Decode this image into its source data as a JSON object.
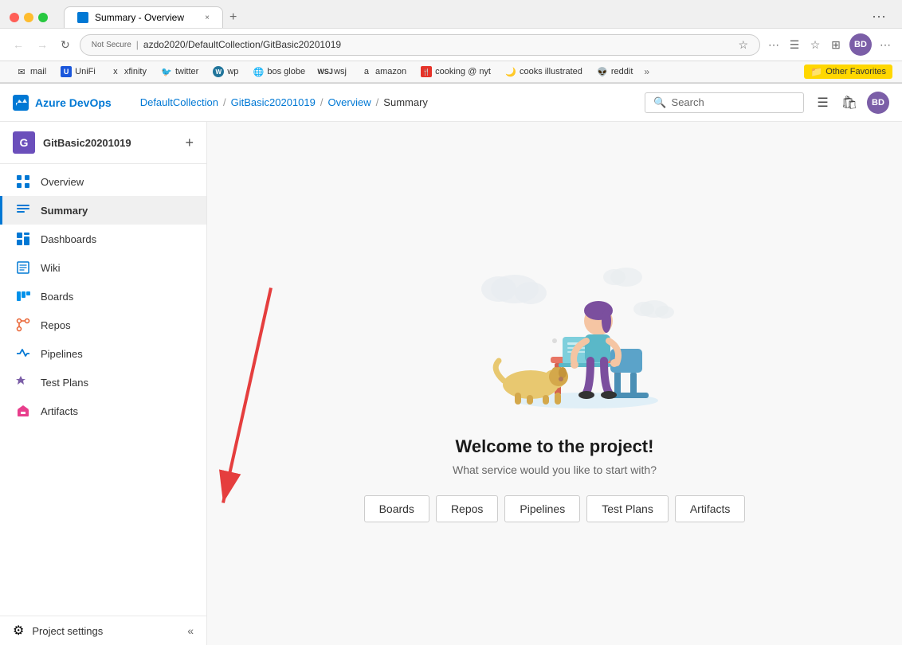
{
  "browser": {
    "tab_title": "Summary - Overview",
    "tab_close": "×",
    "tab_new": "+",
    "nav_back": "←",
    "nav_forward": "→",
    "nav_refresh": "↺",
    "url_secure": "Not Secure",
    "url_address": "azdo2020/DefaultCollection/GitBasic20201019",
    "bookmarks": [
      {
        "label": "mail",
        "icon": "✉"
      },
      {
        "label": "UniFi",
        "icon": "U"
      },
      {
        "label": "xfinity",
        "icon": "x"
      },
      {
        "label": "twitter",
        "icon": "🐦"
      },
      {
        "label": "wp",
        "icon": "W"
      },
      {
        "label": "bos globe",
        "icon": "b"
      },
      {
        "label": "wsj",
        "icon": "W"
      },
      {
        "label": "amazon",
        "icon": "a"
      },
      {
        "label": "cooking @ nyt",
        "icon": "🍴"
      },
      {
        "label": "cooks illustrated",
        "icon": "🌙"
      },
      {
        "label": "reddit",
        "icon": "👽"
      }
    ],
    "other_favorites": "Other Favorites"
  },
  "ado_header": {
    "logo_text": "Azure DevOps",
    "breadcrumb": [
      {
        "label": "DefaultCollection",
        "link": true
      },
      {
        "label": "GitBasic20201019",
        "link": true
      },
      {
        "label": "Overview",
        "link": true
      },
      {
        "label": "Summary",
        "link": false
      }
    ],
    "search_placeholder": "Search",
    "user_initials": "BD"
  },
  "sidebar": {
    "project_initial": "G",
    "project_name": "GitBasic20201019",
    "add_label": "+",
    "nav_items": [
      {
        "label": "Overview",
        "active": false,
        "icon": "overview"
      },
      {
        "label": "Summary",
        "active": true,
        "icon": "summary"
      },
      {
        "label": "Dashboards",
        "active": false,
        "icon": "dashboards"
      },
      {
        "label": "Wiki",
        "active": false,
        "icon": "wiki"
      },
      {
        "label": "Boards",
        "active": false,
        "icon": "boards"
      },
      {
        "label": "Repos",
        "active": false,
        "icon": "repos"
      },
      {
        "label": "Pipelines",
        "active": false,
        "icon": "pipelines"
      },
      {
        "label": "Test Plans",
        "active": false,
        "icon": "testplans"
      },
      {
        "label": "Artifacts",
        "active": false,
        "icon": "artifacts"
      }
    ],
    "footer_icon": "⚙",
    "footer_label": "Project settings",
    "collapse_icon": "«"
  },
  "main": {
    "welcome_title": "Welcome to the project!",
    "welcome_subtitle": "What service would you like to start with?",
    "service_buttons": [
      {
        "label": "Boards"
      },
      {
        "label": "Repos"
      },
      {
        "label": "Pipelines"
      },
      {
        "label": "Test Plans"
      },
      {
        "label": "Artifacts"
      }
    ]
  }
}
